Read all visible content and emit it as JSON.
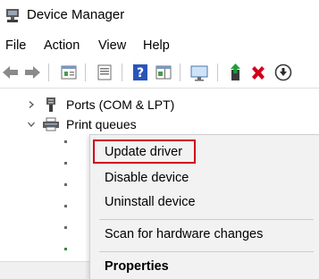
{
  "window": {
    "title": "Device Manager",
    "app_icon": "device-manager-icon"
  },
  "menubar": {
    "items": [
      "File",
      "Action",
      "View",
      "Help"
    ]
  },
  "toolbar": {
    "buttons": [
      "back-arrow-icon",
      "forward-arrow-icon",
      "properties-icon",
      "show-hidden-icon",
      "help-icon",
      "action-pane-icon",
      "scan-monitor-icon",
      "update-driver-icon",
      "uninstall-x-icon",
      "download-circle-icon"
    ],
    "colors": {
      "uninstall": "#d0021b",
      "update_green": "#1f9d3a",
      "help_blue": "#2a55b8"
    }
  },
  "tree": {
    "ports": {
      "label": "Ports (COM & LPT)",
      "expanded": false
    },
    "print_queues": {
      "label": "Print queues",
      "expanded": true
    }
  },
  "context_menu": {
    "update_driver": "Update driver",
    "disable_device": "Disable device",
    "uninstall_device": "Uninstall device",
    "scan_hardware": "Scan for hardware changes",
    "properties": "Properties",
    "highlight_color": "#d0021b"
  }
}
